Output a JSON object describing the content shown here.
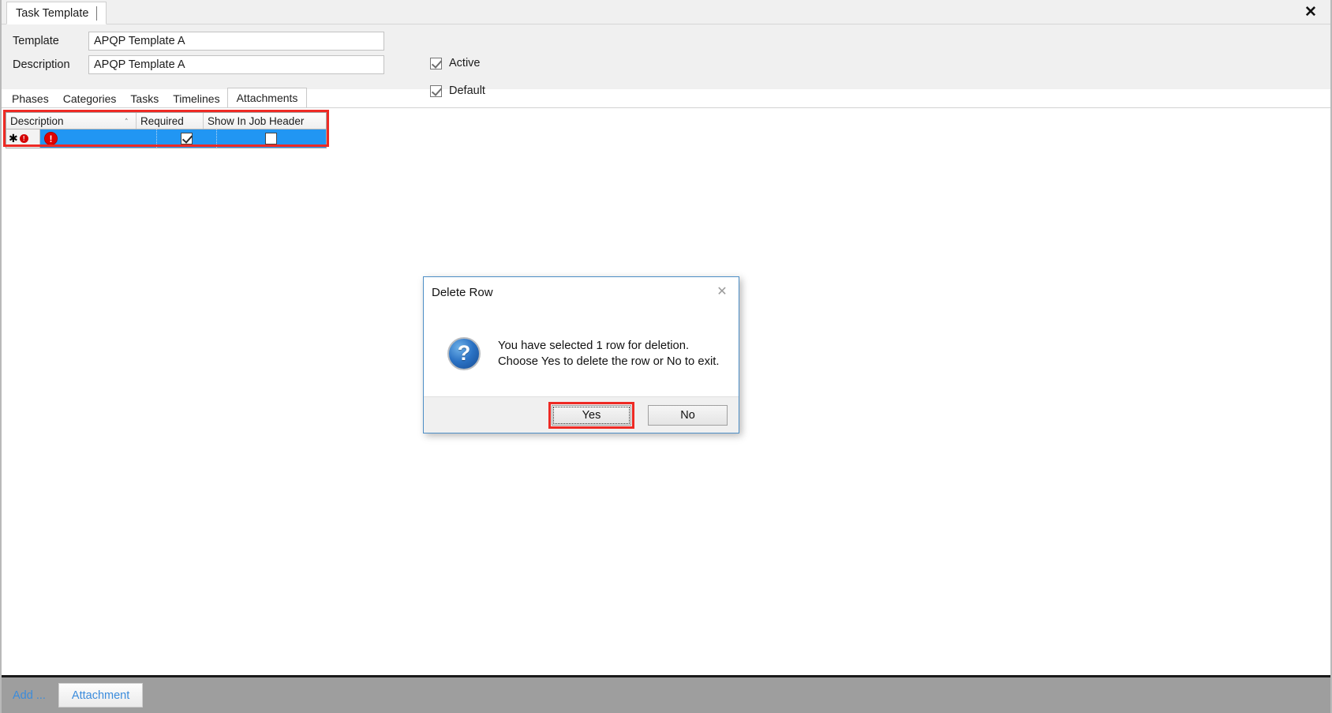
{
  "window": {
    "tab_title": "Task Template",
    "close_label": "✕"
  },
  "form": {
    "template_label": "Template",
    "template_value": "APQP Template A",
    "description_label": "Description",
    "description_value": "APQP Template A",
    "active_label": "Active",
    "active_checked": true,
    "default_label": "Default",
    "default_checked": true
  },
  "tabs": [
    {
      "label": "Phases",
      "active": false
    },
    {
      "label": "Categories",
      "active": false
    },
    {
      "label": "Tasks",
      "active": false
    },
    {
      "label": "Timelines",
      "active": false
    },
    {
      "label": "Attachments",
      "active": true
    }
  ],
  "grid": {
    "columns": [
      {
        "label": "Description",
        "sort": "ascending"
      },
      {
        "label": "Required",
        "sort": ""
      },
      {
        "label": "Show In Job Header",
        "sort": ""
      }
    ],
    "sort_glyph": "⌃",
    "rows": [
      {
        "row_indicator": "new-row",
        "row_indicator_glyph": "✱",
        "error_badge_small": "!",
        "error_badge_large": "!",
        "description": "",
        "required_checked": true,
        "show_in_job_header_checked": false,
        "selected": true
      }
    ],
    "selection_color": "#2196f3",
    "highlight_color": "#ee2a24"
  },
  "dialog": {
    "title": "Delete Row",
    "close_label": "✕",
    "icon": "question-icon",
    "icon_glyph": "?",
    "message_line1": "You have selected 1 row for deletion.",
    "message_line2": "Choose Yes to delete the row or No to exit.",
    "yes_label": "Yes",
    "no_label": "No",
    "focused_button": "Yes",
    "highlight_color": "#ee2a24"
  },
  "bottom_bar": {
    "add_label": "Add ...",
    "attachment_label": "Attachment",
    "link_color": "#3b8cdc"
  }
}
